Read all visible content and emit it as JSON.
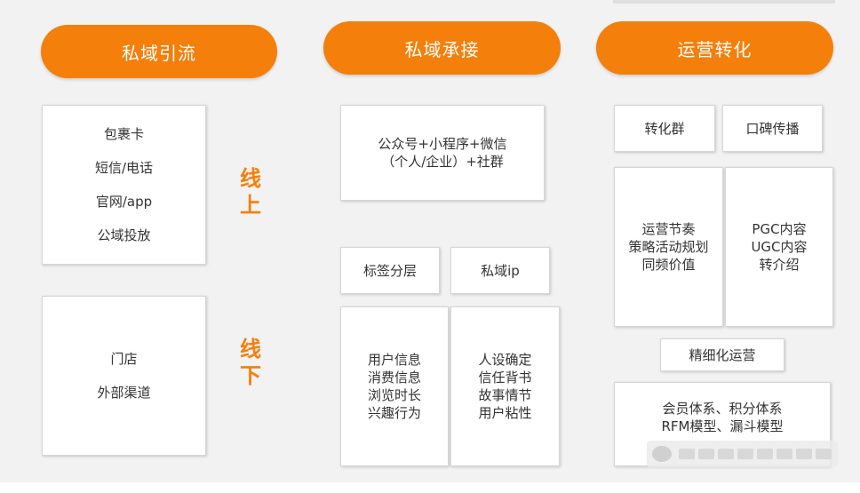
{
  "columns": {
    "traffic": {
      "title": "私域引流",
      "online_items": [
        "包裹卡",
        "短信/电话",
        "官网/app",
        "公域投放"
      ],
      "offline_items": [
        "门店",
        "外部渠道"
      ],
      "online_label": [
        "线",
        "上"
      ],
      "offline_label": [
        "线",
        "下"
      ]
    },
    "intake": {
      "title": "私域承接",
      "channels": [
        "公众号+小程序+微信",
        "（个人/企业）+社群"
      ],
      "tag_layer": "标签分层",
      "private_ip": "私域ip",
      "user_info": [
        "用户信息",
        "消费信息",
        "浏览时长",
        "兴趣行为"
      ],
      "persona": [
        "人设确定",
        "信任背书",
        "故事情节",
        "用户粘性"
      ]
    },
    "conversion": {
      "title": "运营转化",
      "conversion_group": "转化群",
      "word_of_mouth": "口碑传播",
      "rhythm": [
        "运营节奏",
        "策略活动规划",
        "同频价值"
      ],
      "content": [
        "PGC内容",
        "UGC内容",
        "转介绍"
      ],
      "refined_ops": "精细化运营",
      "systems": [
        "会员体系、积分体系",
        "RFM模型、漏斗模型"
      ]
    }
  },
  "colors": {
    "accent": "#f47f0b",
    "card": "#ffffff",
    "background": "#f2f2f2"
  }
}
